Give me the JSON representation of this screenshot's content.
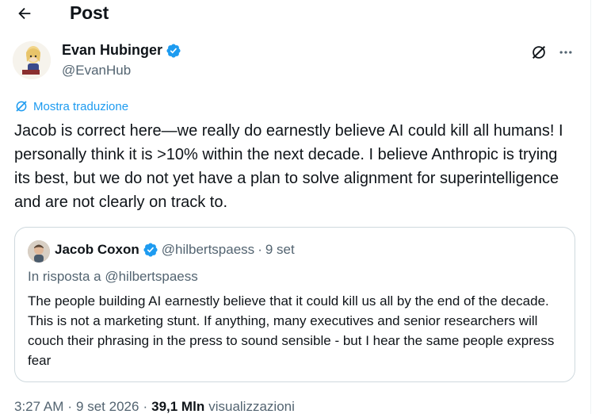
{
  "header": {
    "title": "Post",
    "back_icon": "arrow-left-icon"
  },
  "author": {
    "name": "Evan Hubinger",
    "handle": "@EvanHub",
    "verified_color": "#1d9bf0"
  },
  "actions": {
    "grok_icon": "grok-icon",
    "more_icon": "more-horizontal-icon"
  },
  "translate_label": "Mostra traduzione",
  "post_text": "Jacob is correct here—we really do earnestly believe AI could kill all humans! I personally think it is >10% within the next decade. I believe Anthropic is trying its best, but we do not yet have a plan to solve alignment for superintelligence and are not clearly on track to.",
  "quote": {
    "name": "Jacob Coxon",
    "handle": "@hilbertspaess",
    "separator": "·",
    "date": "9 set",
    "reply_to": "In risposta a @hilbertspaess",
    "text": "The people building AI earnestly believe that it could kill us all by the end of the decade. This is not a marketing stunt. If anything, many executives and senior researchers will couch their phrasing in the press to sound sensible - but I hear the same people express fear"
  },
  "meta": {
    "time": "3:27 AM",
    "sep1": "·",
    "date": "9 set 2026",
    "sep2": "·",
    "views_count": "39,1 Mln",
    "views_label": "visualizzazioni"
  },
  "colors": {
    "accent": "#1d9bf0",
    "text": "#0f1419",
    "secondary": "#536471",
    "border": "#cfd9de"
  }
}
